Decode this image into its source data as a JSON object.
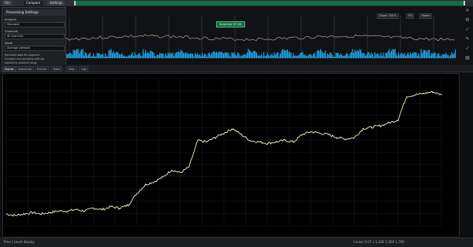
{
  "tabs": [
    "File",
    "Compare",
    "Settings"
  ],
  "panel": {
    "title": "Processing Settings",
    "field1_label": "Analysis",
    "field1_value": "Standard",
    "field2_label": "Channels",
    "field2_value": "All channels",
    "field3_label": "Mode",
    "field3_value": "Average (default)",
    "info_lines": [
      "Recorded data file segment",
      "Duration and sampling settings",
      "Applied to selected range"
    ]
  },
  "overview": {
    "tag": "Selected 07:42",
    "toolbar_labels": [
      "Zoom 100%",
      "Fit",
      "Reset"
    ]
  },
  "control_tabs": [
    "Signal",
    "Spectrum",
    "Events",
    "Table",
    "Map",
    "Log"
  ],
  "status": {
    "left": "Time / Level display",
    "right": "Cursor 0.07 s 1,300 1,500 1,700"
  },
  "colors": {
    "accent": "#1a6a46",
    "trace": "#f2f2c0",
    "spectrum": "#1ea6e8"
  },
  "chart_data": {
    "type": "line",
    "grid": true,
    "ylim": [
      0,
      100
    ],
    "x": [
      0,
      2,
      4,
      6,
      8,
      10,
      12,
      14,
      16,
      18,
      20,
      22,
      24,
      26,
      28,
      30,
      32,
      34,
      36,
      38,
      40,
      42,
      44,
      46,
      48,
      50,
      52,
      54,
      56,
      58,
      60,
      62,
      64,
      66,
      68,
      70,
      72,
      74,
      76,
      78,
      80,
      82,
      84,
      86,
      88,
      90,
      92,
      94,
      96,
      98,
      100
    ],
    "values": [
      8,
      7,
      8,
      9,
      8,
      9,
      10,
      10,
      11,
      10,
      12,
      11,
      13,
      12,
      14,
      22,
      28,
      30,
      33,
      38,
      36,
      40,
      58,
      57,
      60,
      63,
      66,
      62,
      58,
      57,
      56,
      57,
      58,
      57,
      62,
      64,
      63,
      62,
      60,
      59,
      60,
      66,
      67,
      68,
      70,
      72,
      88,
      89,
      90,
      91,
      89
    ]
  }
}
